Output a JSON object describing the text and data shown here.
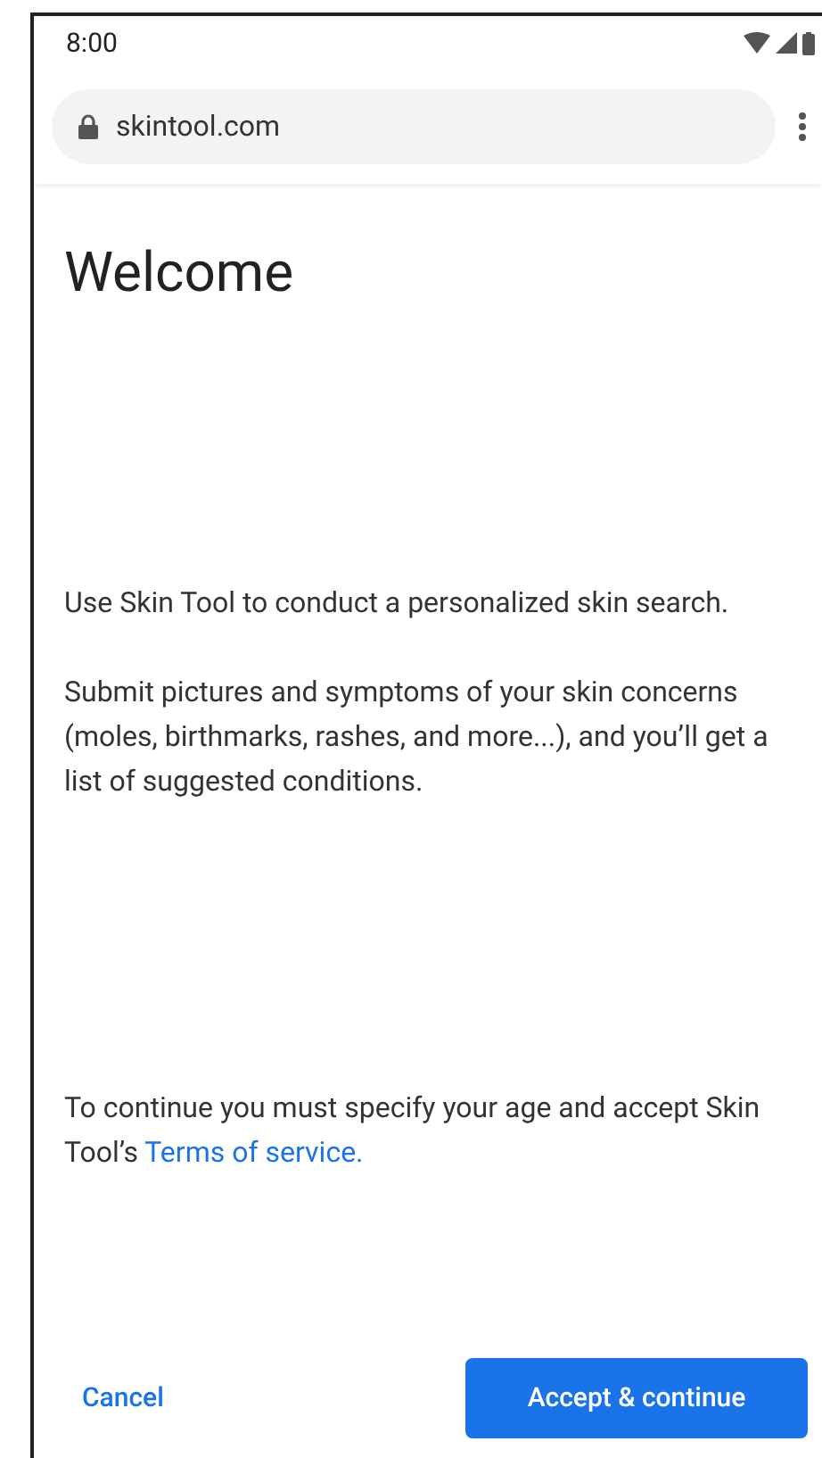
{
  "status_bar": {
    "time": "8:00"
  },
  "browser": {
    "url": "skintool.com"
  },
  "page": {
    "title": "Welcome",
    "paragraphs": [
      "Use Skin Tool to conduct a personalized skin search.",
      "Submit pictures and symptoms of your skin concerns (moles, birthmarks, rashes, and more...), and you’ll get a list of suggested conditions."
    ],
    "consent_text": "To continue you must specify your age and accept Skin Tool’s ",
    "terms_link": "Terms of service."
  },
  "buttons": {
    "cancel": "Cancel",
    "accept": "Accept & continue"
  }
}
